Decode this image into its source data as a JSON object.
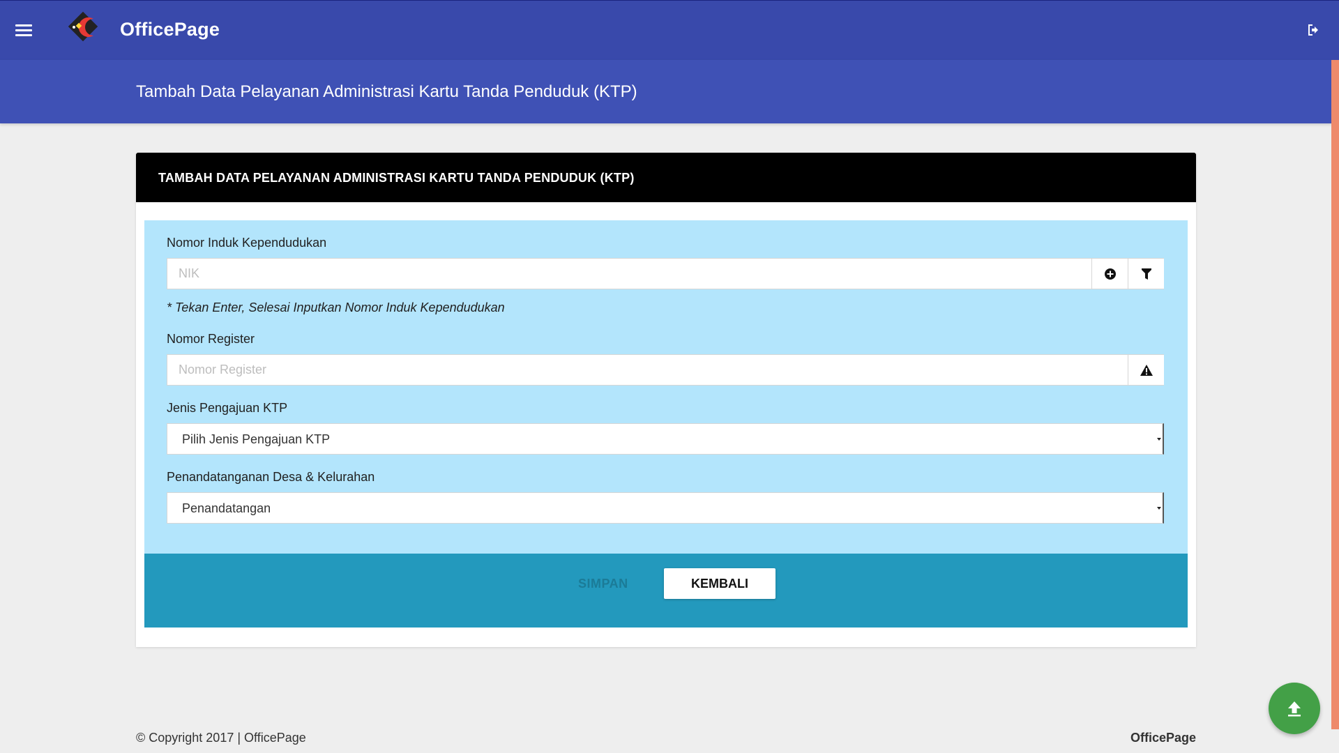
{
  "app": {
    "brand": "OfficePage",
    "accent_color": "#3f51b5",
    "topbar_color": "#3949ab"
  },
  "topbar": {
    "menu_icon": "hamburger-menu-icon",
    "logout_icon": "logout-icon"
  },
  "page": {
    "title": "Tambah Data Pelayanan Administrasi Kartu Tanda Penduduk (KTP)"
  },
  "card": {
    "header": "TAMBAH DATA PELAYANAN ADMINISTRASI KARTU TANDA PENDUDUK (KTP)"
  },
  "form": {
    "nik": {
      "label": "Nomor Induk Kependudukan",
      "placeholder": "NIK",
      "value": "",
      "add_icon": "plus-circle-icon",
      "filter_icon": "filter-icon",
      "hint": "* Tekan Enter, Selesai Inputkan Nomor Induk Kependudukan"
    },
    "register": {
      "label": "Nomor Register",
      "placeholder": "Nomor Register",
      "value": "",
      "warning_icon": "warning-icon"
    },
    "jenis": {
      "label": "Jenis Pengajuan KTP",
      "selected": "Pilih Jenis Pengajuan KTP"
    },
    "penandatangan": {
      "label": "Penandatanganan Desa & Kelurahan",
      "selected": "Penandatangan"
    }
  },
  "actions": {
    "save_label": "SIMPAN",
    "back_label": "KEMBALI"
  },
  "footer": {
    "copyright": "© Copyright 2017 | OfficePage",
    "brand": "OfficePage"
  },
  "fab": {
    "icon": "upload-arrow-icon",
    "color": "#43a047"
  }
}
